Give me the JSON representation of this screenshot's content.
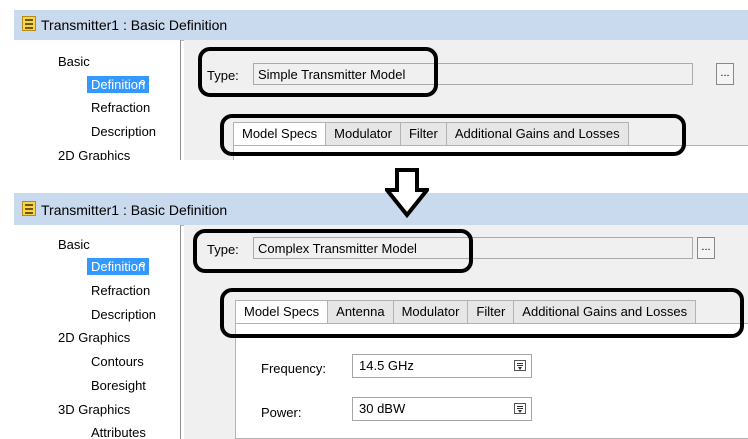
{
  "top_window": {
    "title": "Transmitter1 : Basic Definition",
    "nav": {
      "basic": "Basic",
      "definition": "Definition",
      "refraction": "Refraction",
      "description": "Description",
      "graphics_2d": "2D Graphics"
    },
    "type_label": "Type:",
    "type_value": "Simple Transmitter Model",
    "ellipsis_label": "...",
    "tabs": [
      "Model Specs",
      "Modulator",
      "Filter",
      "Additional Gains and Losses"
    ]
  },
  "bottom_window": {
    "title": "Transmitter1 : Basic Definition",
    "nav": {
      "basic": "Basic",
      "definition": "Definition",
      "refraction": "Refraction",
      "description": "Description",
      "graphics_2d": "2D Graphics",
      "contours": "Contours",
      "boresight": "Boresight",
      "graphics_3d": "3D Graphics",
      "attributes": "Attributes"
    },
    "type_label": "Type:",
    "type_value": "Complex Transmitter Model",
    "ellipsis_label": "...",
    "tabs": [
      "Model Specs",
      "Antenna",
      "Modulator",
      "Filter",
      "Additional Gains and Losses"
    ],
    "fields": {
      "frequency_label": "Frequency:",
      "frequency_value": "14.5 GHz",
      "power_label": "Power:",
      "power_value": "30 dBW"
    }
  },
  "colors": {
    "titlebar": "#c9d9ee",
    "selection": "#3399ff",
    "highlight_outline": "#000000"
  }
}
